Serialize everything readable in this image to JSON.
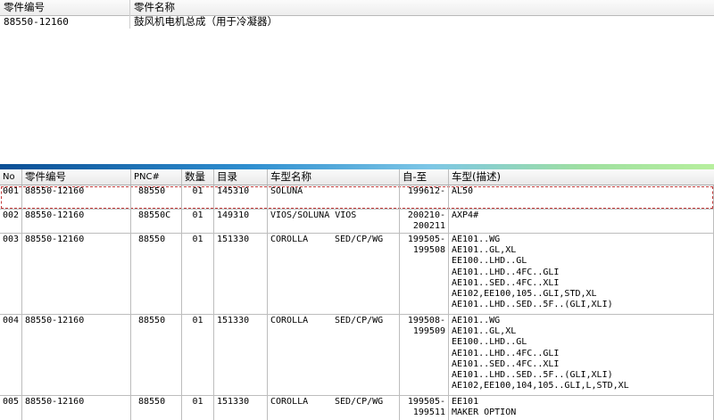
{
  "top_table": {
    "headers": [
      "零件编号",
      "零件名称"
    ],
    "rows": [
      {
        "part_no": "88550-12160",
        "part_name": "鼓风机电机总成（用于冷凝器）"
      }
    ]
  },
  "bottom_table": {
    "headers": {
      "no": "No",
      "part_no": "零件编号",
      "pnc": "PNC#",
      "qty": "数量",
      "catalog": "目录",
      "model_name": "车型名称",
      "date": "自-至",
      "model_desc": "车型(描述)"
    },
    "rows": [
      {
        "no": "001",
        "part_no": "88550-12160",
        "pnc": "88550",
        "qty": "01",
        "catalog": "145310",
        "model": "SOLUNA",
        "body": "",
        "date": [
          "199612-",
          ""
        ],
        "desc": [
          "AL50"
        ]
      },
      {
        "no": "002",
        "part_no": "88550-12160",
        "pnc": "88550C",
        "qty": "01",
        "catalog": "149310",
        "model": "VIOS/SOLUNA VIOS",
        "body": "",
        "date": [
          "200210-",
          "200211"
        ],
        "desc": [
          "AXP4#"
        ]
      },
      {
        "no": "003",
        "part_no": "88550-12160",
        "pnc": "88550",
        "qty": "01",
        "catalog": "151330",
        "model": "COROLLA",
        "body": "SED/CP/WG",
        "date": [
          "199505-",
          "199508"
        ],
        "desc": [
          "AE101..WG",
          "AE101..GL,XL",
          "EE100..LHD..GL",
          "AE101..LHD..4FC..GLI",
          "AE101..SED..4FC..XLI",
          "AE102,EE100,105..GLI,STD,XL",
          "AE101..LHD..SED..5F..(GLI,XLI)"
        ]
      },
      {
        "no": "004",
        "part_no": "88550-12160",
        "pnc": "88550",
        "qty": "01",
        "catalog": "151330",
        "model": "COROLLA",
        "body": "SED/CP/WG",
        "date": [
          "199508-",
          "199509"
        ],
        "desc": [
          "AE101..WG",
          "AE101..GL,XL",
          "EE100..LHD..GL",
          "AE101..LHD..4FC..GLI",
          "AE101..SED..4FC..XLI",
          "AE101..LHD..SED..5F..(GLI,XLI)",
          "AE102,EE100,104,105..GLI,L,STD,XL"
        ]
      },
      {
        "no": "005",
        "part_no": "88550-12160",
        "pnc": "88550",
        "qty": "01",
        "catalog": "151330",
        "model": "COROLLA",
        "body": "SED/CP/WG",
        "date": [
          "199505-",
          "199511"
        ],
        "desc": [
          "EE101",
          "MAKER OPTION"
        ]
      }
    ]
  }
}
